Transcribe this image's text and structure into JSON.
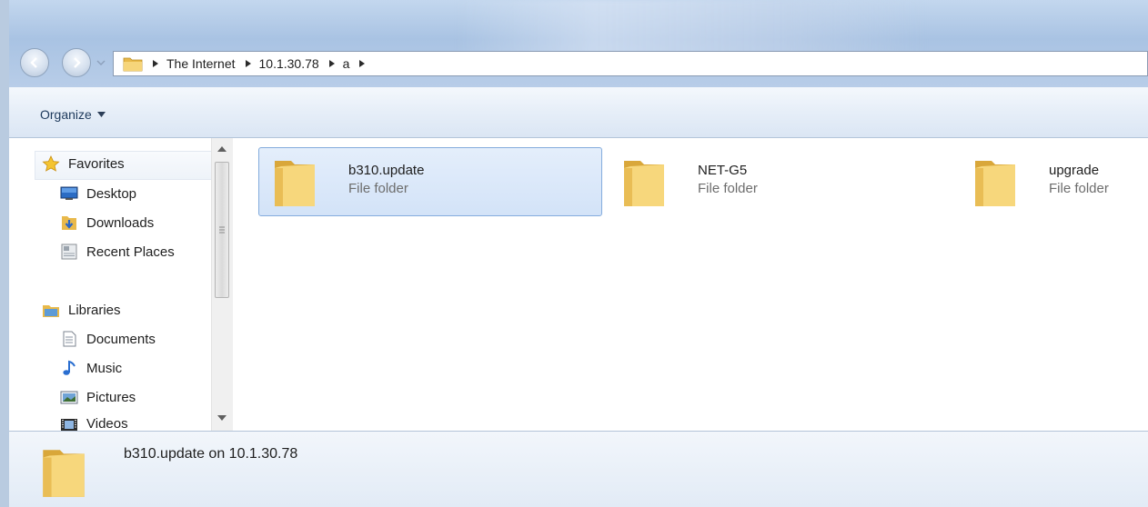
{
  "address": {
    "breadcrumbs": [
      "The Internet",
      "10.1.30.78",
      "a"
    ]
  },
  "toolbar": {
    "organize_label": "Organize"
  },
  "nav": {
    "favorites_label": "Favorites",
    "desktop_label": "Desktop",
    "downloads_label": "Downloads",
    "recent_label": "Recent Places",
    "libraries_label": "Libraries",
    "documents_label": "Documents",
    "music_label": "Music",
    "pictures_label": "Pictures",
    "videos_label": "Videos"
  },
  "items": [
    {
      "name": "b310.update",
      "type": "File folder",
      "selected": true
    },
    {
      "name": "NET-G5",
      "type": "File folder",
      "selected": false
    },
    {
      "name": "upgrade",
      "type": "File folder",
      "selected": false
    }
  ],
  "details": {
    "text": "b310.update on 10.1.30.78"
  },
  "colors": {
    "selection_fill": "#d3e3f8",
    "selection_border": "#84acdd",
    "glass": "#b8cde8"
  }
}
